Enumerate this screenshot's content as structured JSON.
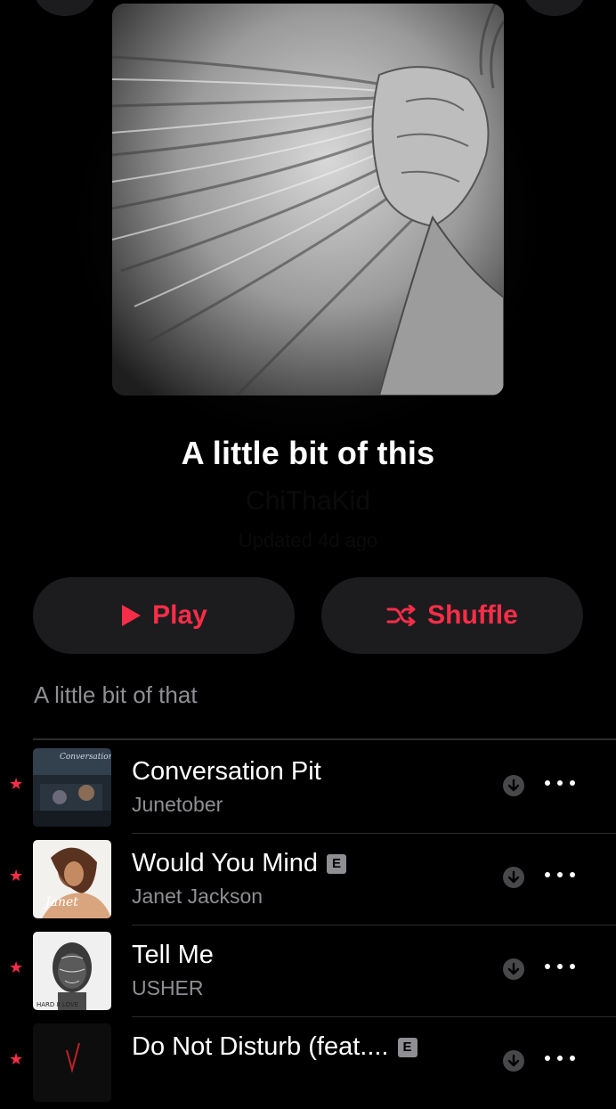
{
  "playlist": {
    "title": "A little bit of this",
    "author": "ChiThaKid",
    "updated": "Updated 4d ago",
    "description": "A little bit of that"
  },
  "actions": {
    "play_label": "Play",
    "shuffle_label": "Shuffle"
  },
  "colors": {
    "accent": "#fa2d48",
    "background": "#000000",
    "secondary_text": "#8e8e93",
    "button_bg": "#1c1c1e"
  },
  "tracks": [
    {
      "title": "Conversation Pit",
      "artist": "Junetober",
      "explicit": false,
      "favorited": true,
      "cover_text": "Conversation Pit"
    },
    {
      "title": "Would You Mind",
      "artist": "Janet Jackson",
      "explicit": true,
      "favorited": true,
      "cover_text": "Janet"
    },
    {
      "title": "Tell Me",
      "artist": "USHER",
      "explicit": false,
      "favorited": true,
      "cover_text": "HARD II LOVE"
    },
    {
      "title": "Do Not Disturb (feat....",
      "artist": "",
      "explicit": true,
      "favorited": true,
      "cover_text": ""
    }
  ],
  "icons": {
    "favorite": "star-icon",
    "download": "download-circle-icon",
    "more": "ellipsis-icon",
    "play": "play-triangle-icon",
    "shuffle": "shuffle-icon"
  },
  "explicit_label": "E"
}
